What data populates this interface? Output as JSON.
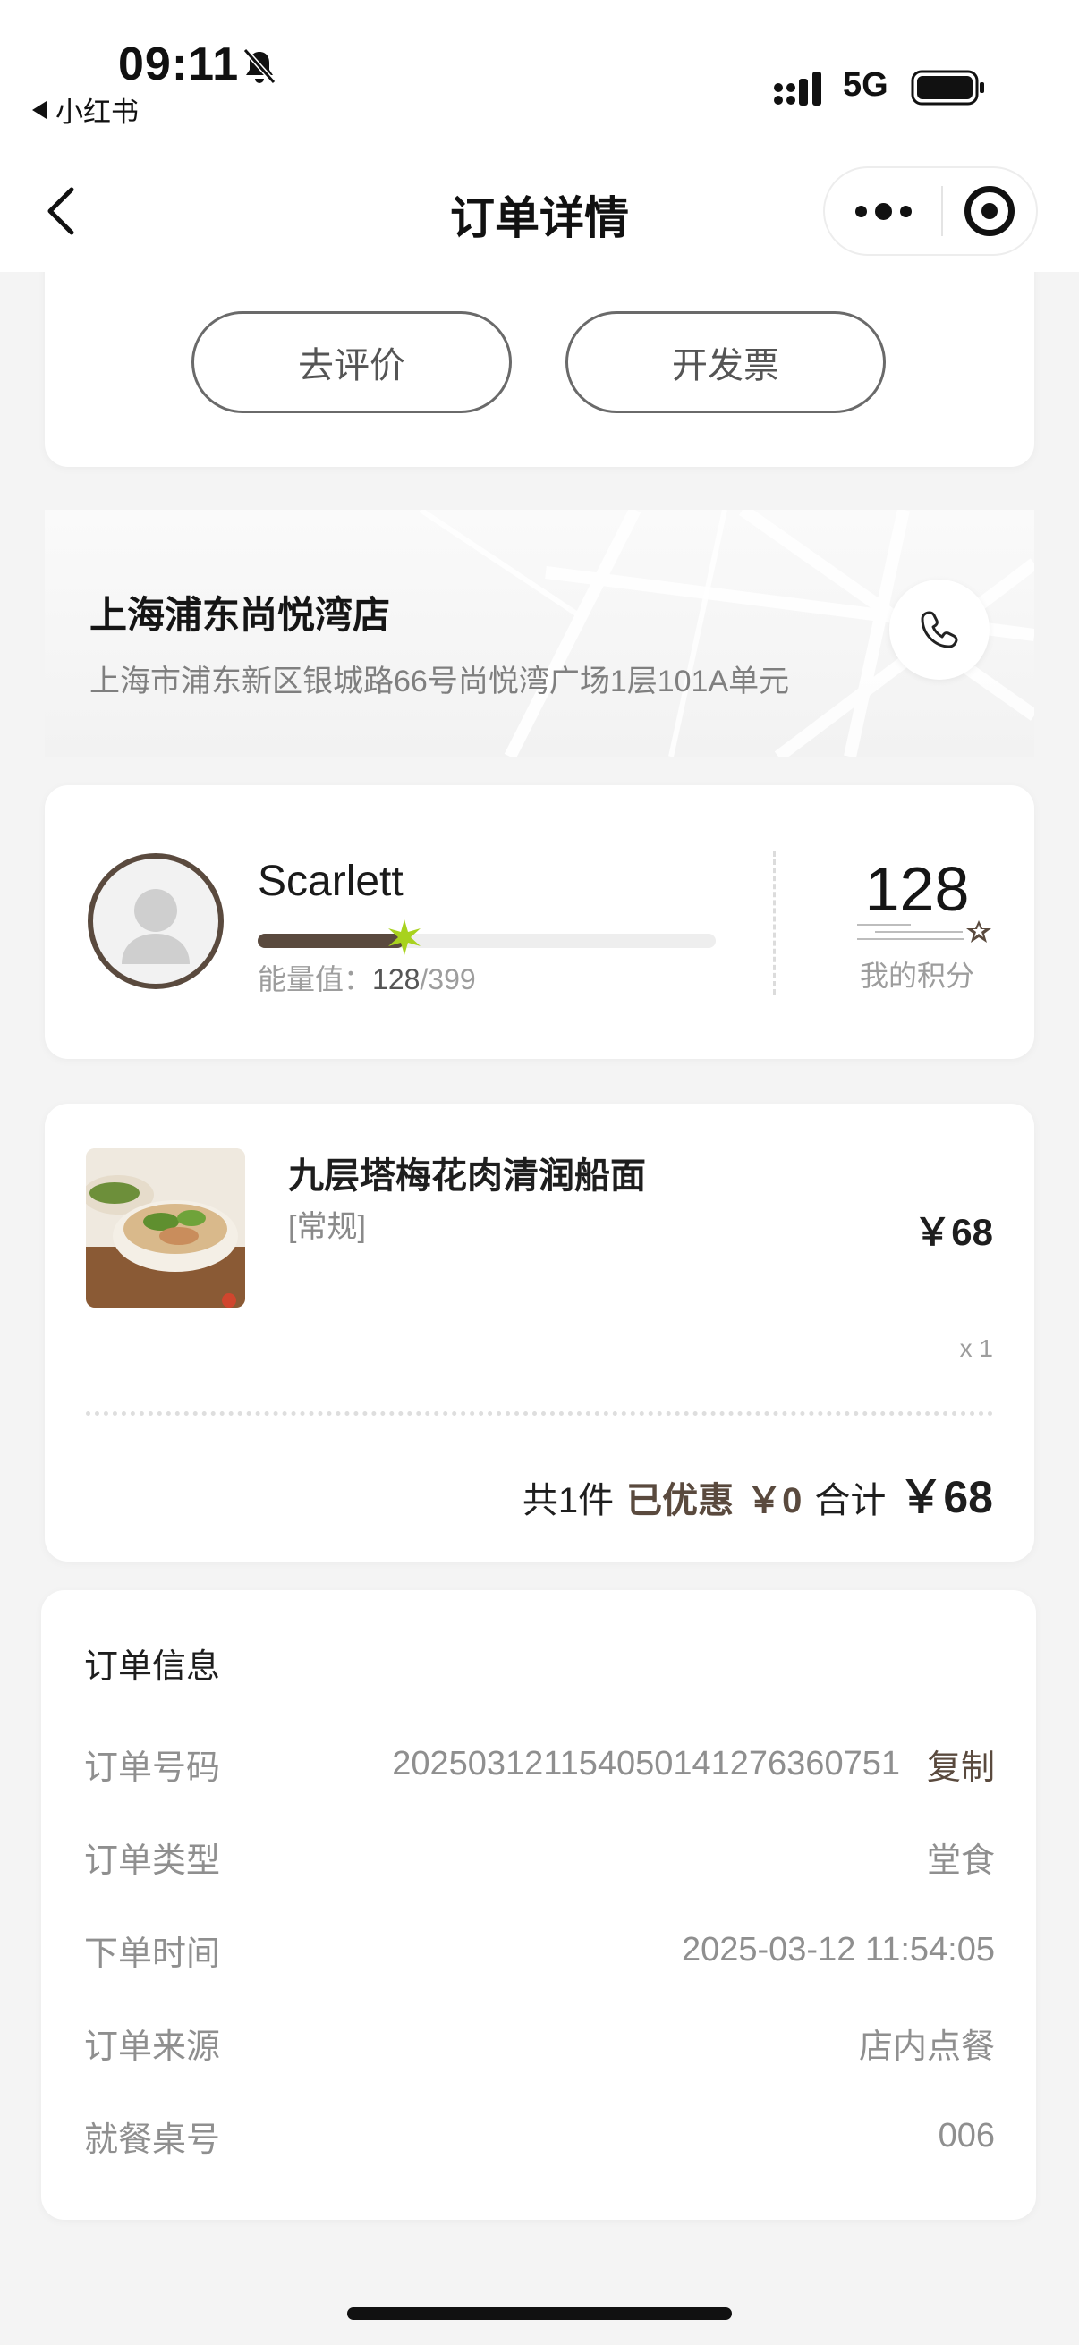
{
  "status_bar": {
    "time": "09:11",
    "back_app": "小红书",
    "network": "5G"
  },
  "nav": {
    "title": "订单详情"
  },
  "actions": {
    "review_label": "去评价",
    "invoice_label": "开发票"
  },
  "store": {
    "name": "上海浦东尚悦湾店",
    "address": "上海市浦东新区银城路66号尚悦湾广场1层101A单元"
  },
  "member": {
    "name": "Scarlett",
    "energy_label": "能量值：",
    "energy_current": "128",
    "energy_sep_max": "/399",
    "energy_fraction": 0.3208,
    "points": "128",
    "points_label": "我的积分"
  },
  "order_item": {
    "name": "九层塔梅花肉清润船面",
    "spec": "[常规]",
    "price": "￥68",
    "qty": "x 1",
    "count_text": "共1件",
    "discount_label": "已优惠",
    "discount_value": "￥0",
    "total_label": "合计",
    "total_value": "￥68"
  },
  "order_info": {
    "title": "订单信息",
    "rows": [
      {
        "label": "订单号码",
        "value": "20250312115405014127636​0751",
        "action": "复制"
      },
      {
        "label": "订单类型",
        "value": "堂食"
      },
      {
        "label": "下单时间",
        "value": "2025-03-12 11:54:05"
      },
      {
        "label": "订单来源",
        "value": "店内点餐"
      },
      {
        "label": "就餐桌号",
        "value": "006"
      }
    ]
  },
  "colors": {
    "accent_brown": "#5a4a3e",
    "star_green": "#a8d21e",
    "background": "#f4f4f4"
  }
}
